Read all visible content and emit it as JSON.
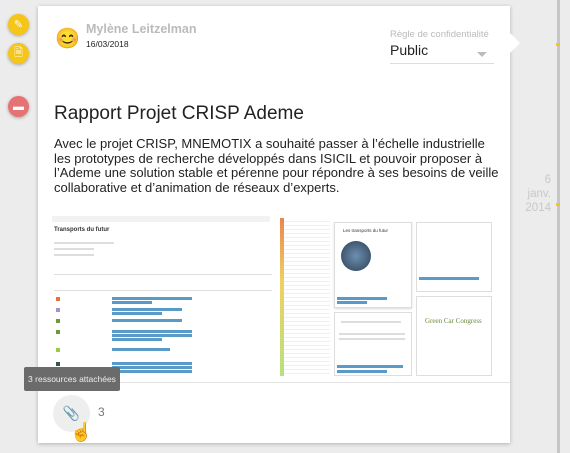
{
  "actions": {
    "edit_icon": "pencil-icon",
    "export_icon": "file-download-icon",
    "delete_icon": "trash-icon"
  },
  "post": {
    "author": "Mylène Leitzelman",
    "date": "16/03/2018",
    "privacy_label": "Règle de confidentialité",
    "privacy_value": "Public",
    "title": "Rapport Projet CRISP Ademe",
    "body": "Avec le projet CRISP, MNEMOTIX a souhaité passer à l’échelle industrielle les prototypes de recherche développés dans ISICIL et pouvoir proposer à l’Ademe une solution stable et pérenne pour répondre à ses besoins de veille collaborative et d’animation de réseaux d’experts.",
    "screenshot_title": "Transports du futur",
    "screenshot_card_title": "Les transports du futur",
    "screenshot_card2_title": "Green Car Congress",
    "attachments_count": "3",
    "attachments_tooltip": "3 ressources attachées"
  },
  "timeline": {
    "day": "6",
    "month": "janv.",
    "year": "2014"
  },
  "colors": {
    "edit": "#f5c518",
    "delete": "#e57373",
    "timeline_tick": "#f5c518"
  }
}
